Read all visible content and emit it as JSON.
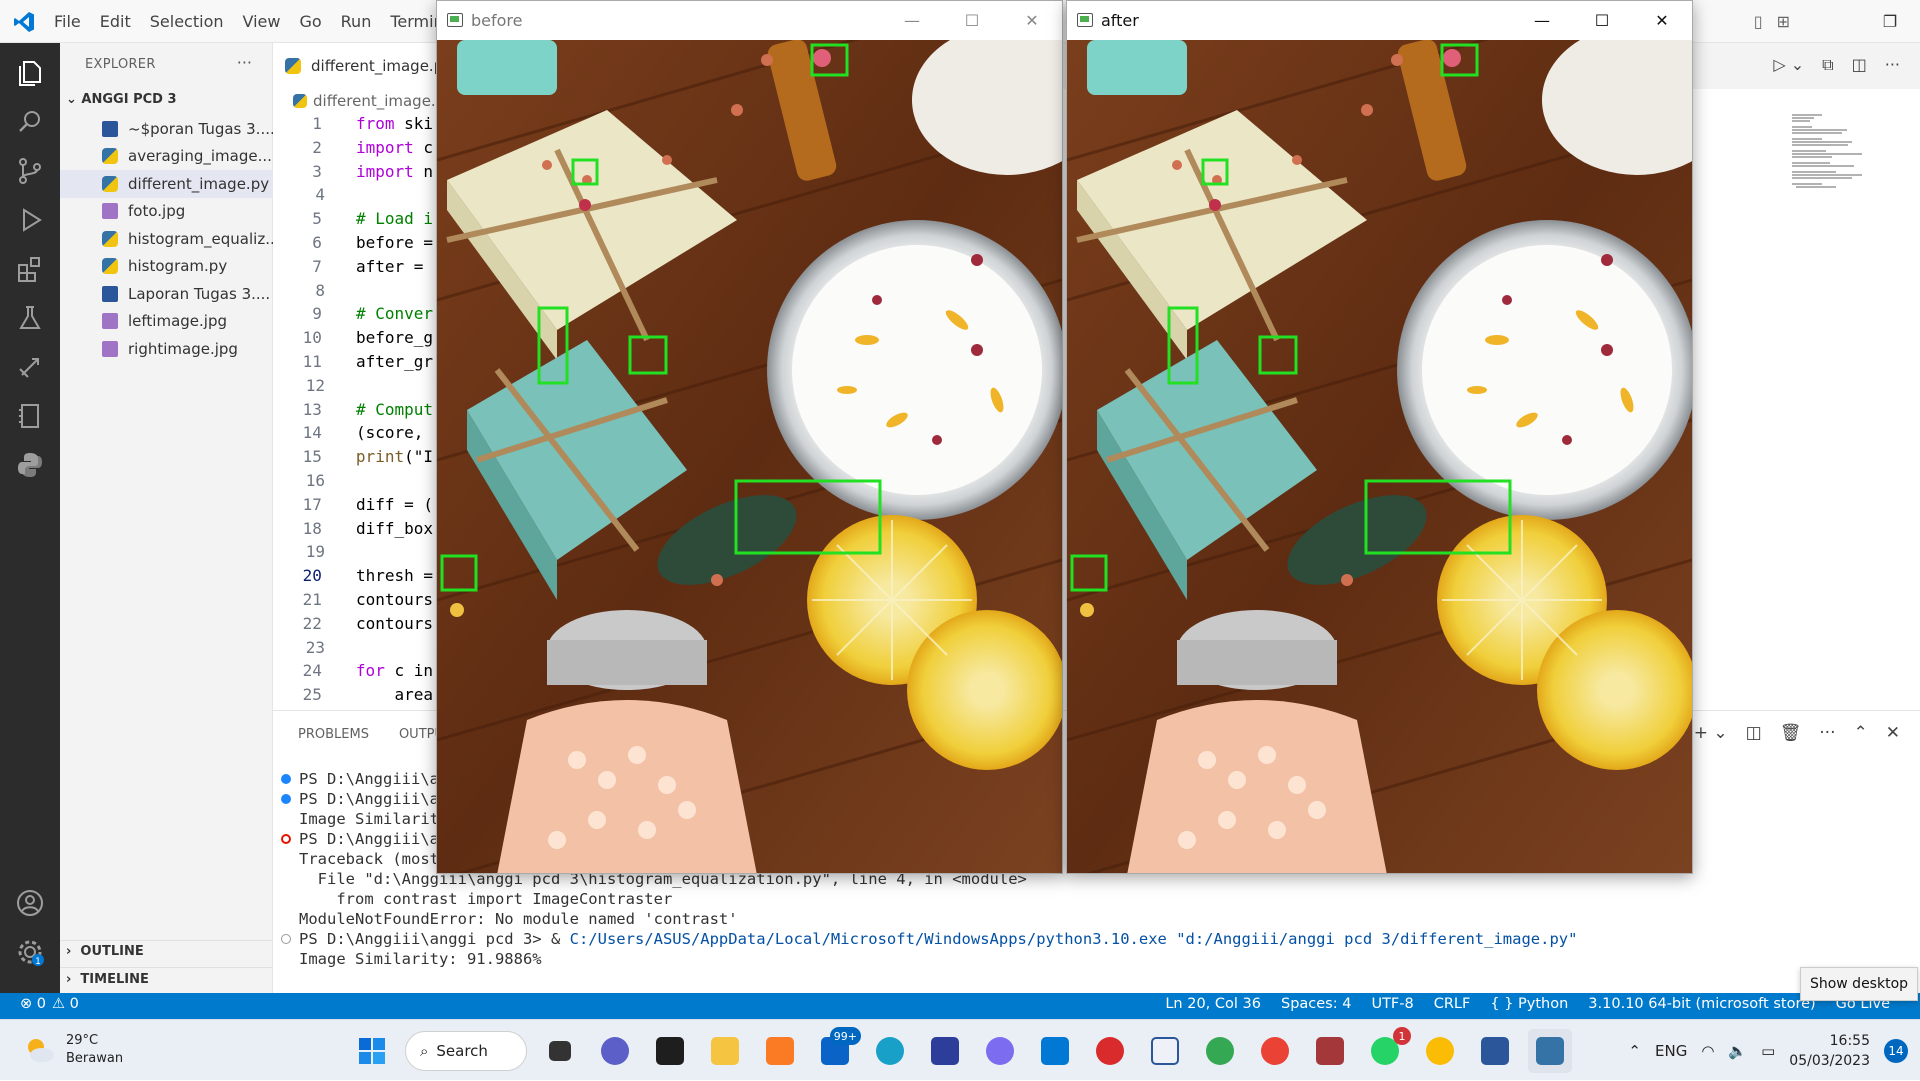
{
  "menu": [
    "File",
    "Edit",
    "Selection",
    "View",
    "Go",
    "Run",
    "Terminal"
  ],
  "explorer": {
    "header": "EXPLORER",
    "folder": "ANGGI PCD 3",
    "files": [
      {
        "name": "~$poran Tugas 3....",
        "type": "word"
      },
      {
        "name": "averaging_image....",
        "type": "py"
      },
      {
        "name": "different_image.py",
        "type": "py"
      },
      {
        "name": "foto.jpg",
        "type": "img"
      },
      {
        "name": "histogram_equaliz...",
        "type": "py"
      },
      {
        "name": "histogram.py",
        "type": "py"
      },
      {
        "name": "Laporan Tugas 3....",
        "type": "word"
      },
      {
        "name": "leftimage.jpg",
        "type": "img"
      },
      {
        "name": "rightimage.jpg",
        "type": "img"
      }
    ],
    "outline": "OUTLINE",
    "timeline": "TIMELINE"
  },
  "editor": {
    "tab": "different_image.p",
    "breadcrumb": "different_image.",
    "lines": [
      {
        "n": "1",
        "text": "from ski"
      },
      {
        "n": "2",
        "text": "import c"
      },
      {
        "n": "3",
        "text": "import n"
      },
      {
        "n": "4",
        "text": ""
      },
      {
        "n": "5",
        "text": "# Load i"
      },
      {
        "n": "6",
        "text": "before ="
      },
      {
        "n": "7",
        "text": "after = "
      },
      {
        "n": "8",
        "text": ""
      },
      {
        "n": "9",
        "text": "# Conver"
      },
      {
        "n": "10",
        "text": "before_g"
      },
      {
        "n": "11",
        "text": "after_gr"
      },
      {
        "n": "12",
        "text": ""
      },
      {
        "n": "13",
        "text": "# Comput"
      },
      {
        "n": "14",
        "text": "(score, "
      },
      {
        "n": "15",
        "text": "print(\"I"
      },
      {
        "n": "16",
        "text": ""
      },
      {
        "n": "17",
        "text": "diff = ("
      },
      {
        "n": "18",
        "text": "diff_box"
      },
      {
        "n": "19",
        "text": ""
      },
      {
        "n": "20",
        "text": "thresh ="
      },
      {
        "n": "21",
        "text": "contours"
      },
      {
        "n": "22",
        "text": "contours"
      },
      {
        "n": "23",
        "text": ""
      },
      {
        "n": "24",
        "text": "for c in"
      },
      {
        "n": "25",
        "text": "    area"
      }
    ]
  },
  "panel": {
    "tabs": [
      "PROBLEMS",
      "OUTPU"
    ],
    "terminal": [
      {
        "marker": "blue",
        "text": "PS D:\\Anggiii\\an"
      },
      {
        "marker": "blue",
        "text": "PS D:\\Anggiii\\an"
      },
      {
        "marker": "none",
        "text": "Image Similarity"
      },
      {
        "marker": "err",
        "text": "PS D:\\Anggiii\\an"
      },
      {
        "marker": "none",
        "text": "Traceback (most"
      },
      {
        "marker": "none",
        "text": "  File \"d:\\Anggiii\\anggi pcd 3\\histogram_equalization.py\", line 4, in <module>"
      },
      {
        "marker": "none",
        "text": "    from contrast import ImageContraster"
      },
      {
        "marker": "none",
        "text": "ModuleNotFoundError: No module named 'contrast'"
      },
      {
        "marker": "empty",
        "text": "PS D:\\Anggiii\\anggi pcd 3> & ",
        "link": "C:/Users/ASUS/AppData/Local/Microsoft/WindowsApps/python3.10.exe",
        "arg": " \"d:/Anggiii/anggi pcd 3/different_image.py\""
      },
      {
        "marker": "none",
        "text": "Image Similarity: 91.9886%"
      }
    ]
  },
  "statusbar": {
    "left": [
      "⊗ 0",
      "⚠ 0"
    ],
    "right": [
      "Ln 20, Col 36",
      "Spaces: 4",
      "UTF-8",
      "CRLF",
      "{ } Python",
      "3.10.10 64-bit (microsoft store)",
      "Go Live"
    ]
  },
  "tooltip": "Show desktop",
  "windows": {
    "before": {
      "title": "before"
    },
    "after": {
      "title": "after"
    }
  },
  "taskbar": {
    "weather_temp": "29°C",
    "weather_desc": "Berawan",
    "search": "Search",
    "mail_badge": "99+",
    "whatsapp_badge": "1",
    "lang": "ENG",
    "time": "16:55",
    "date": "05/03/2023",
    "notif": "14"
  },
  "colors": {
    "accent": "#007acc",
    "activity_bar": "#2c2c2c",
    "box": "#22e022"
  }
}
